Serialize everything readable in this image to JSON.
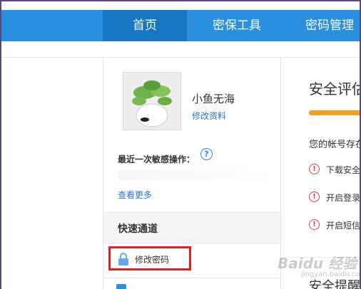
{
  "nav": {
    "items": [
      {
        "label": "首页"
      },
      {
        "label": "密保工具"
      },
      {
        "label": "密码管理"
      }
    ]
  },
  "profile": {
    "username": "小鱼无海",
    "edit_link": "修改资料"
  },
  "sensitive": {
    "label": "最近一次敏感操作：",
    "help_glyph": "?"
  },
  "view_more": "查看更多",
  "quick": {
    "title": "快速通道",
    "change_password": "修改密码"
  },
  "security": {
    "title": "安全评估",
    "account_text": "您的帐号存在风险",
    "warnings": [
      "下载安全",
      "开启登录",
      "开启短信"
    ],
    "hint_title": "安全提醒"
  },
  "watermark": {
    "text": "Baidu 经验",
    "sub": "jingyan.baidu.com"
  }
}
